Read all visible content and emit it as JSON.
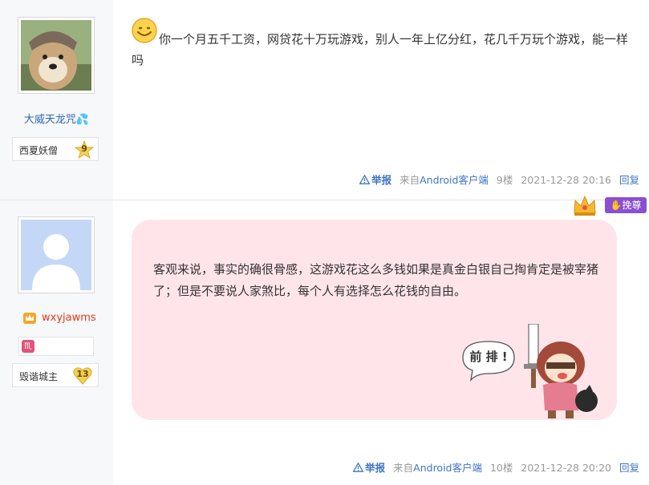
{
  "posts": [
    {
      "username": "大威天龙咒💦",
      "badge_title": "西夏妖僧",
      "level": "9",
      "content": "你一个月五千工资，网贷花十万玩游戏，别人一年上亿分红，花几千万玩个游戏，能一样吗",
      "report": "举报",
      "source_prefix": "来自",
      "source_client": "Android客户端",
      "floor": "9楼",
      "time": "2021-12-28 20:16",
      "reply": "回复"
    },
    {
      "username": "wxyjawms",
      "badge_title": "毁谐城主",
      "level": "13",
      "vip_tag": "挽尊",
      "content": "客观来说，事实的确很骨感，这游戏花这么多钱如果是真金白银自己掏肯定是被宰猪了；但是不要说人家煞比，每个人有选择怎么花钱的自由。",
      "sticker_text": "前 排 !",
      "report": "举报",
      "source_prefix": "来自",
      "source_client": "Android客户端",
      "floor": "10楼",
      "time": "2021-12-28 20:20",
      "reply": "回复"
    }
  ]
}
